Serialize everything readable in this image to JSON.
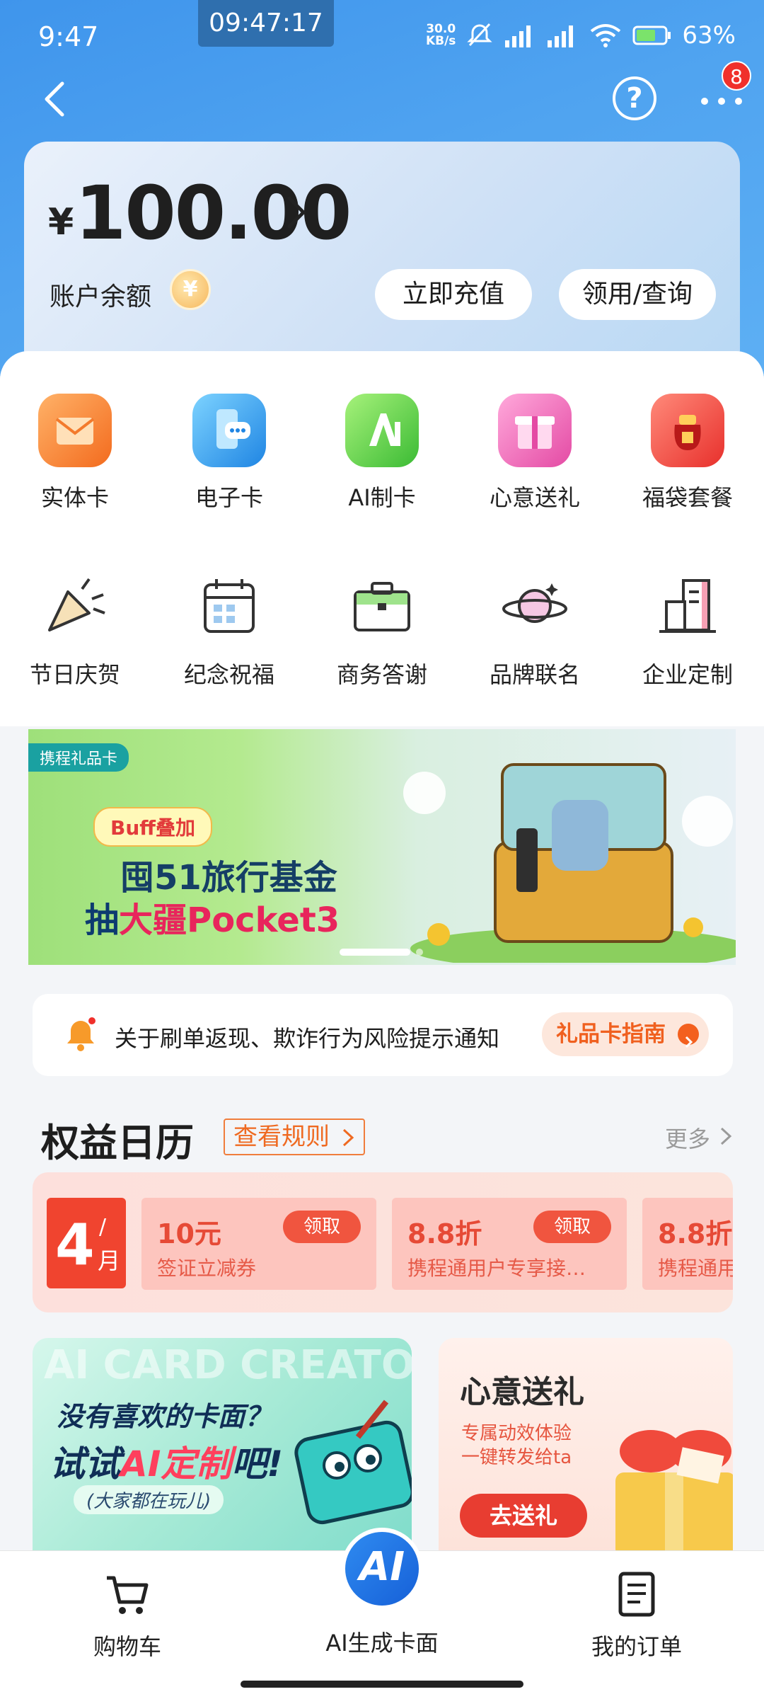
{
  "status_bar": {
    "time": "9:47",
    "clock_overlay": "09:47:17",
    "net_speed_value": "30.0",
    "net_speed_unit": "KB/s",
    "battery": "63%"
  },
  "header": {
    "back_icon": "chevron-left-icon",
    "help_label": "?",
    "notification_count": "8"
  },
  "balance": {
    "currency": "¥",
    "amount": "100.00",
    "label": "账户余额",
    "coin_icon": "¥",
    "recharge_label": "立即充值",
    "query_label": "领用/查询"
  },
  "grid_row1": [
    {
      "label": "实体卡",
      "icon": "envelope-icon",
      "color": "#f7832f"
    },
    {
      "label": "电子卡",
      "icon": "chat-phone-icon",
      "color": "#2a9be8"
    },
    {
      "label": "AI制卡",
      "icon": "ai-icon",
      "color": "#3fc43a"
    },
    {
      "label": "心意送礼",
      "icon": "gift-icon",
      "color": "#ee5fb1"
    },
    {
      "label": "福袋套餐",
      "icon": "lucky-bag-icon",
      "color": "#ee3a3a"
    }
  ],
  "grid_row2": [
    {
      "label": "节日庆贺",
      "icon": "party-popper-icon"
    },
    {
      "label": "纪念祝福",
      "icon": "calendar-icon"
    },
    {
      "label": "商务答谢",
      "icon": "briefcase-icon"
    },
    {
      "label": "品牌联名",
      "icon": "planet-icon"
    },
    {
      "label": "企业定制",
      "icon": "building-icon"
    }
  ],
  "banner": {
    "tag": "携程礼品卡",
    "buff": "Buff叠加",
    "line1": "囤51旅行基金",
    "line2_prefix": "抽",
    "line2_highlight": "大疆Pocket3"
  },
  "notice": {
    "text": "关于刷单返现、欺诈行为风险提示通知",
    "guide_label": "礼品卡指南"
  },
  "calendar": {
    "title": "权益日历",
    "rules_label": "查看规则",
    "more_label": "更多",
    "month_num": "4",
    "month_slash": "/",
    "month_unit": "月",
    "coupons": [
      {
        "value": "10元",
        "desc": "签证立减券",
        "claim": "领取"
      },
      {
        "value": "8.8折",
        "desc": "携程通用户专享接…",
        "claim": "领取"
      },
      {
        "value": "8.8折",
        "desc": "携程通用",
        "claim": ""
      }
    ]
  },
  "promo_ai": {
    "watermark": "AI CARD CREATOR",
    "line1": "没有喜欢的卡面？",
    "line2_prefix": "试试",
    "line2_highlight": "AI定制",
    "line2_suffix": "吧!",
    "line3": "(大家都在玩儿)"
  },
  "promo_gift": {
    "title": "心意送礼",
    "desc1": "专属动效体验",
    "desc2": "一键转发给ta",
    "button": "去送礼"
  },
  "bottom_nav": {
    "cart_label": "购物车",
    "ai_fab": "AI",
    "ai_label": "AI生成卡面",
    "orders_label": "我的订单"
  }
}
